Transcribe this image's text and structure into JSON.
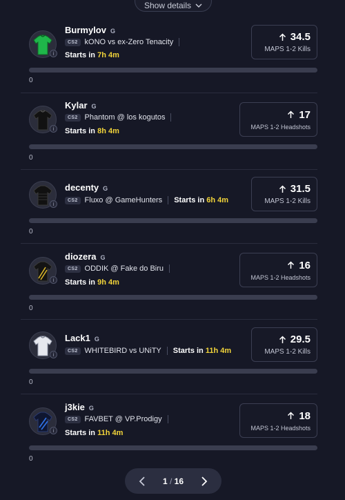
{
  "header": {
    "show_details_label": "Show details"
  },
  "items": [
    {
      "player": "Burmylov",
      "badge": "G",
      "game": "CS2",
      "match": "kONO vs ex-Zero Tenacity",
      "starts_prefix": "Starts in",
      "starts_time": "7h 4m",
      "stat_value": "34.5",
      "stat_label": "MAPS 1-2 Kills",
      "progress_value": "0",
      "jersey": "green"
    },
    {
      "player": "Kylar",
      "badge": "G",
      "game": "CS2",
      "match": "Phantom @ los kogutos",
      "starts_prefix": "Starts in",
      "starts_time": "8h 4m",
      "stat_value": "17",
      "stat_label": "MAPS 1-2 Headshots",
      "progress_value": "0",
      "jersey": "black"
    },
    {
      "player": "decenty",
      "badge": "G",
      "game": "CS2",
      "match": "Fluxo @ GameHunters",
      "starts_prefix": "Starts in",
      "starts_time": "6h 4m",
      "stat_value": "31.5",
      "stat_label": "MAPS 1-2 Kills",
      "progress_value": "0",
      "jersey": "black-stripe"
    },
    {
      "player": "diozera",
      "badge": "G",
      "game": "CS2",
      "match": "ODDIK @ Fake do Biru",
      "starts_prefix": "Starts in",
      "starts_time": "9h 4m",
      "stat_value": "16",
      "stat_label": "MAPS 1-2 Headshots",
      "progress_value": "0",
      "jersey": "black-yellow"
    },
    {
      "player": "Lack1",
      "badge": "G",
      "game": "CS2",
      "match": "WHITEBIRD vs UNiTY",
      "starts_prefix": "Starts in",
      "starts_time": "11h 4m",
      "stat_value": "29.5",
      "stat_label": "MAPS 1-2 Kills",
      "progress_value": "0",
      "jersey": "white"
    },
    {
      "player": "j3kie",
      "badge": "G",
      "game": "CS2",
      "match": "FAVBET @ VP.Prodigy",
      "starts_prefix": "Starts in",
      "starts_time": "11h 4m",
      "stat_value": "18",
      "stat_label": "MAPS 1-2 Headshots",
      "progress_value": "0",
      "jersey": "blue"
    }
  ],
  "pagination": {
    "current": "1",
    "separator": "/",
    "total": "16"
  },
  "colors": {
    "background": "#161826",
    "accent_time": "#f2d43a",
    "bar": "#3a3d4f"
  }
}
